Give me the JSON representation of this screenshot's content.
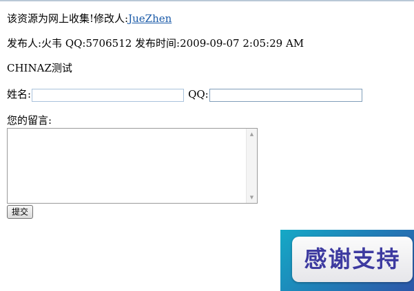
{
  "notice": {
    "text": "该资源为网上收集!修改人:",
    "modifier_name": "JueZhen"
  },
  "publish_info": "发布人:火韦 QQ:5706512 发布时间:2009-09-07 2:05:29 AM",
  "site_text": "CHINAZ测试",
  "form": {
    "name_label": "姓名:",
    "name_value": "",
    "qq_label": "QQ:",
    "qq_value": "",
    "message_label": "您的留言:",
    "message_value": "",
    "submit_label": "提交"
  },
  "banner": {
    "text": "感谢支持"
  },
  "icons": {
    "scroll_up": "scroll-up-arrow",
    "scroll_down": "scroll-down-arrow"
  },
  "colors": {
    "link": "#1a5aa8",
    "banner_text": "#3d3aa0",
    "banner_bg_start": "#15a9c6",
    "banner_bg_end": "#2d56a8"
  }
}
